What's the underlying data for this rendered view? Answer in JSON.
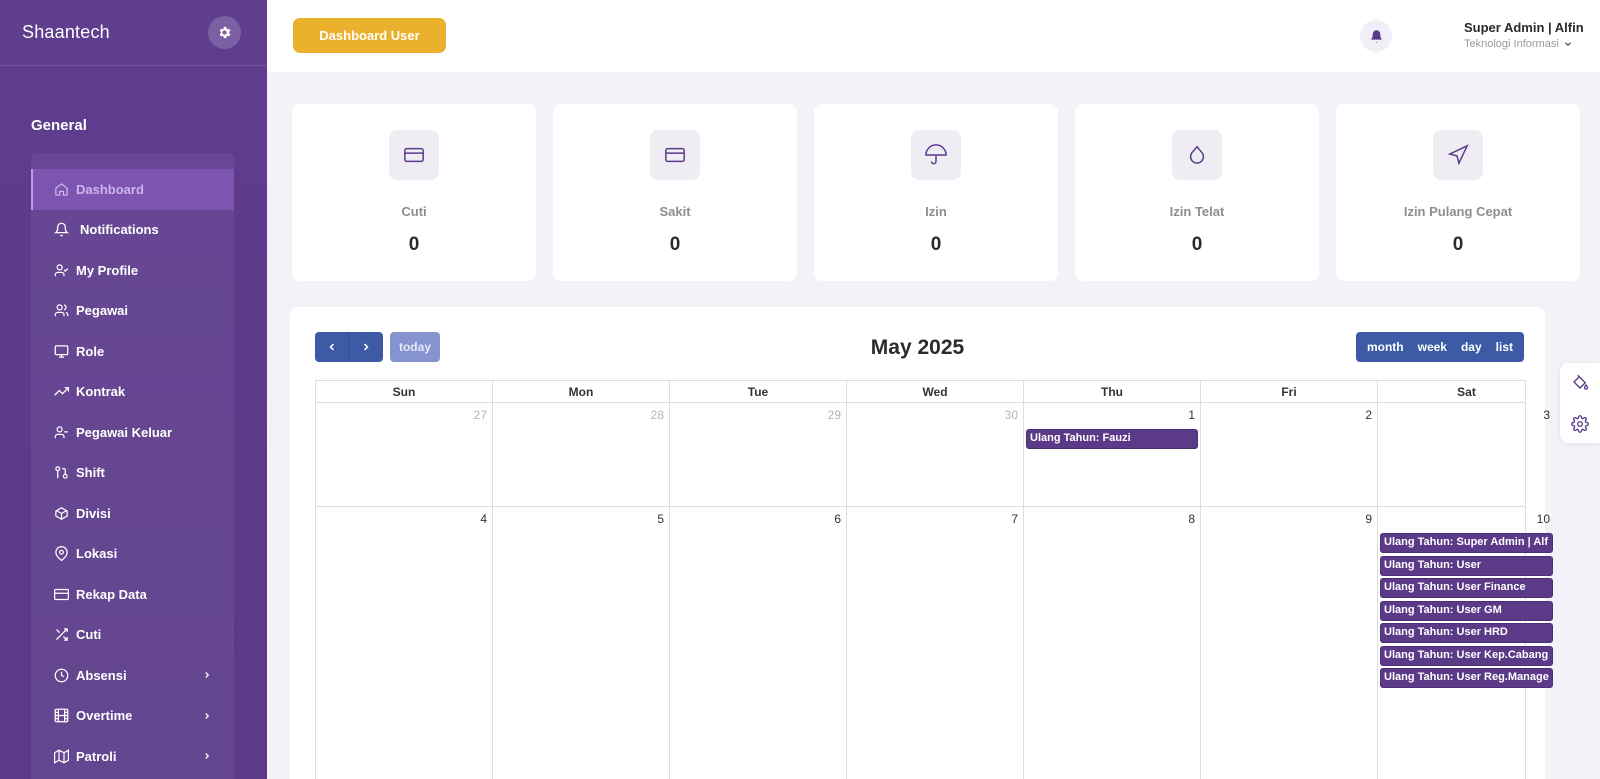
{
  "sidebar": {
    "brand": "Shaantech",
    "section_title": "General",
    "items": [
      {
        "label": "Dashboard",
        "icon": "home-icon"
      },
      {
        "label": "Notifications",
        "icon": "bell-icon"
      },
      {
        "label": "My Profile",
        "icon": "user-check-icon"
      },
      {
        "label": "Pegawai",
        "icon": "users-icon"
      },
      {
        "label": "Role",
        "icon": "monitor-icon"
      },
      {
        "label": "Kontrak",
        "icon": "trending-up-icon"
      },
      {
        "label": "Pegawai Keluar",
        "icon": "user-minus-icon"
      },
      {
        "label": "Shift",
        "icon": "git-pull-request-icon"
      },
      {
        "label": "Divisi",
        "icon": "box-icon"
      },
      {
        "label": "Lokasi",
        "icon": "map-pin-icon"
      },
      {
        "label": "Rekap Data",
        "icon": "credit-card-icon"
      },
      {
        "label": "Cuti",
        "icon": "shuffle-icon"
      },
      {
        "label": "Absensi",
        "icon": "clock-icon"
      },
      {
        "label": "Overtime",
        "icon": "film-icon"
      },
      {
        "label": "Patroli",
        "icon": "map-icon"
      }
    ]
  },
  "header": {
    "dashboard_button": "Dashboard User",
    "user_name": "Super Admin | Alfin",
    "user_dept": "Teknologi Informasi"
  },
  "stats": [
    {
      "label": "Cuti",
      "value": "0",
      "icon": "credit-card-icon"
    },
    {
      "label": "Sakit",
      "value": "0",
      "icon": "credit-card-icon"
    },
    {
      "label": "Izin",
      "value": "0",
      "icon": "umbrella-icon"
    },
    {
      "label": "Izin Telat",
      "value": "0",
      "icon": "droplet-icon"
    },
    {
      "label": "Izin Pulang Cepat",
      "value": "0",
      "icon": "navigation-icon"
    }
  ],
  "calendar": {
    "title": "May 2025",
    "today_label": "today",
    "views": [
      "month",
      "week",
      "day",
      "list"
    ],
    "weekdays": [
      "Sun",
      "Mon",
      "Tue",
      "Wed",
      "Thu",
      "Fri",
      "Sat"
    ],
    "week1": [
      "27",
      "28",
      "29",
      "30",
      "1",
      "2",
      "3"
    ],
    "week2": [
      "4",
      "5",
      "6",
      "7",
      "8",
      "9",
      "10"
    ],
    "events_thu1": [
      "Ulang Tahun: Fauzi"
    ],
    "events_sat10": [
      "Ulang Tahun: Super Admin | Alf",
      "Ulang Tahun: User",
      "Ulang Tahun: User Finance",
      "Ulang Tahun: User GM",
      "Ulang Tahun: User HRD",
      "Ulang Tahun: User Kep.Cabang",
      "Ulang Tahun: User Reg.Manage"
    ]
  },
  "colors": {
    "sidebar_bg": "#5e3c8c",
    "accent_yellow": "#ebb02c",
    "calendar_button": "#3c5aa6",
    "event_bg": "#5b3a88"
  }
}
